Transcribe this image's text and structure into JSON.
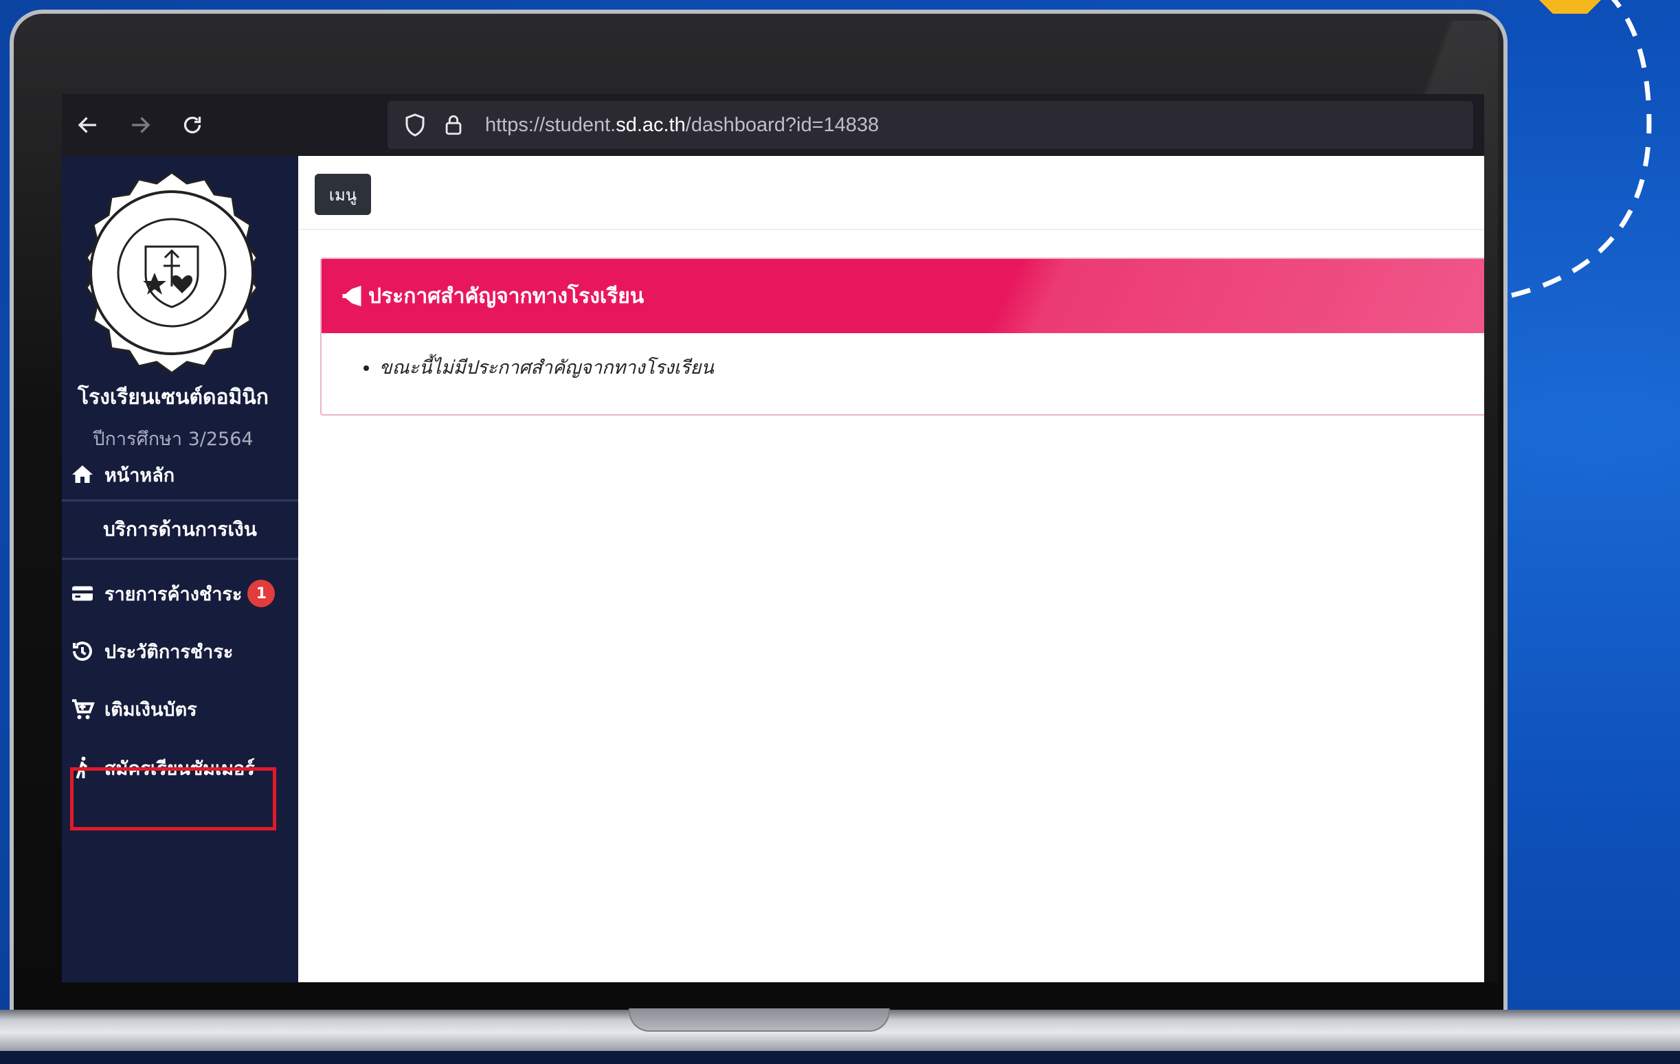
{
  "browser": {
    "url_prefix": "https://student.",
    "url_domain": "sd.ac.th",
    "url_suffix": "/dashboard?id=14838"
  },
  "sidebar": {
    "school_name": "โรงเรียนเซนต์ดอมินิก",
    "school_year": "ปีการศึกษา 3/2564",
    "home_label": "หน้าหลัก",
    "section_title": "บริการด้านการเงิน",
    "items": [
      {
        "label": "รายการค้างชำระ",
        "icon": "credit-card-icon",
        "badge": "1"
      },
      {
        "label": "ประวัติการชำระ",
        "icon": "history-icon"
      },
      {
        "label": "เติมเงินบัตร",
        "icon": "cart-icon"
      },
      {
        "label": "สมัครเรียนซัมเมอร์",
        "icon": "person-walking-icon",
        "highlighted": true
      }
    ]
  },
  "main": {
    "menu_button": "เมนู",
    "announcement_title": "ประกาศสำคัญจากทางโรงเรียน",
    "announcement_items": [
      "ขณะนี้ไม่มีประกาศสำคัญจากทางโรงเรียน"
    ]
  },
  "colors": {
    "sidebar_bg": "#161c3c",
    "alert_header": "#e8175d",
    "highlight_border": "#e11a2a",
    "badge": "#e23c3c",
    "background_blue": "#0d4fb8"
  }
}
